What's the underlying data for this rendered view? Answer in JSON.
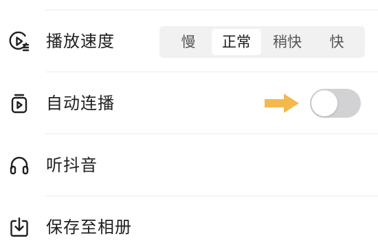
{
  "settings": {
    "items": [
      {
        "id": "playback-speed",
        "label": "播放速度",
        "icon": "play-speed-icon",
        "options": [
          "慢",
          "正常",
          "稍快",
          "快"
        ],
        "selected": "正常"
      },
      {
        "id": "autoplay",
        "label": "自动连播",
        "icon": "autoplay-icon",
        "toggle_on": false
      },
      {
        "id": "listen-douyin",
        "label": "听抖音",
        "icon": "headphones-icon"
      },
      {
        "id": "save-to-album",
        "label": "保存至相册",
        "icon": "download-icon"
      }
    ]
  },
  "annotation": {
    "arrow_color": "#f3b94d",
    "arrow_target": "autoplay-toggle"
  },
  "colors": {
    "toggle_off": "#d2d2d4",
    "segment_background": "#f1f1f2",
    "divider": "#ececec"
  }
}
